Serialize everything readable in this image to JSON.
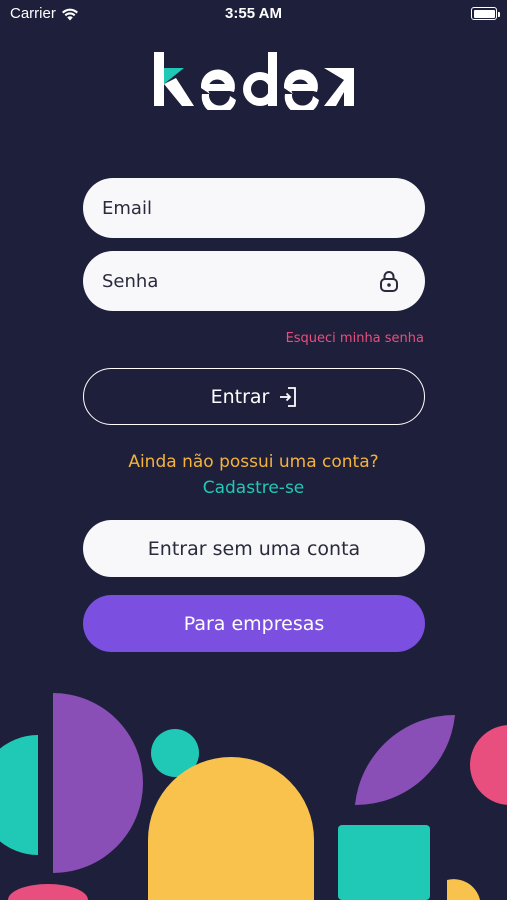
{
  "status_bar": {
    "carrier": "Carrier",
    "time": "3:55 AM",
    "battery_level": 1.0
  },
  "brand": {
    "name": "kedek",
    "accent_color": "#1fc9b6"
  },
  "login_form": {
    "email_placeholder": "Email",
    "password_placeholder": "Senha",
    "password_icon": "lock-icon",
    "forgot_password_label": "Esqueci minha senha",
    "submit_label": "Entrar",
    "submit_icon": "enter-icon"
  },
  "signup": {
    "question": "Ainda não possui uma conta?",
    "link_label": "Cadastre-se"
  },
  "guest_button_label": "Entrar sem uma conta",
  "business_button_label": "Para empresas",
  "colors": {
    "background": "#1e1f3a",
    "pink": "#e94f7e",
    "yellow": "#f5b33b",
    "teal": "#1fc9b6",
    "purple": "#8a4fb6",
    "button_purple": "#7b4fe0"
  }
}
